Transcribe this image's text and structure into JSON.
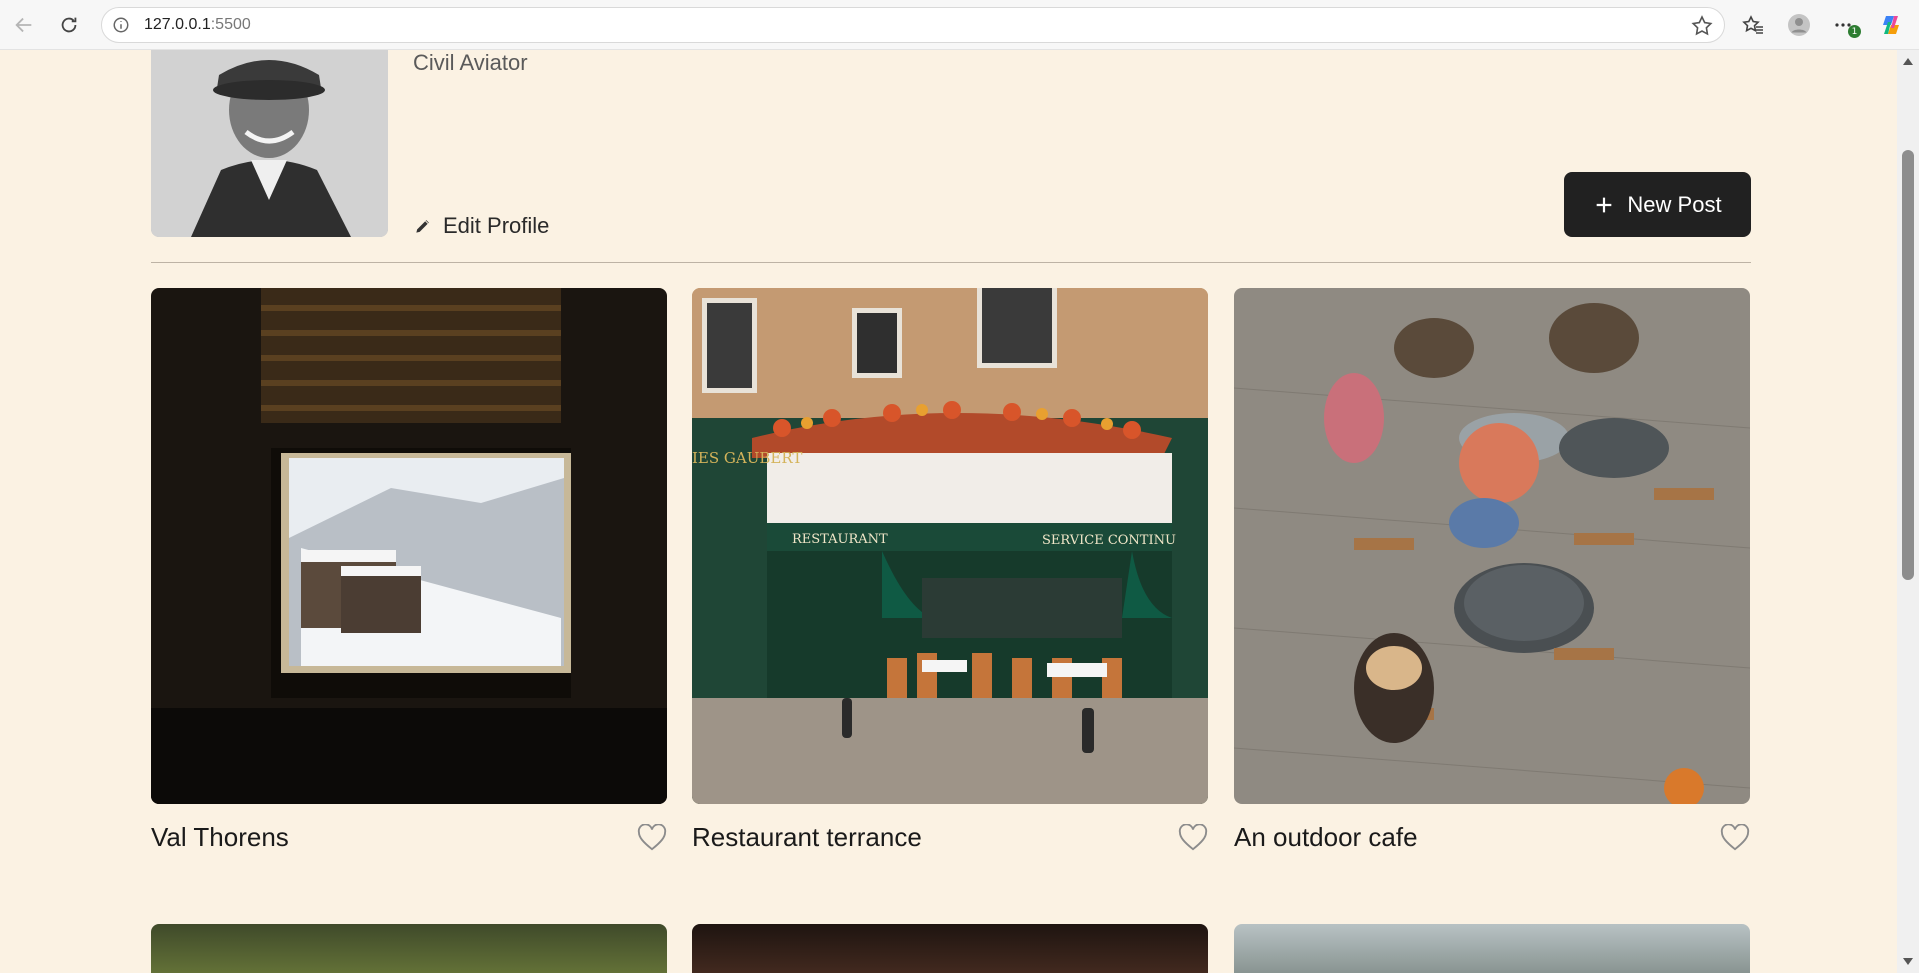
{
  "browser": {
    "url_host": "127.0.0.1",
    "url_port": ":5500"
  },
  "profile": {
    "description": "Civil Aviator",
    "edit_label": "Edit Profile",
    "new_post_label": "New Post"
  },
  "cards": [
    {
      "title": "Val Thorens"
    },
    {
      "title": "Restaurant terrance"
    },
    {
      "title": "An outdoor cafe"
    }
  ],
  "image_text": {
    "awning_left": "RESTAURANT",
    "awning_right": "SERVICE CONTINU",
    "shop_sign": "IES GAUBERT"
  }
}
